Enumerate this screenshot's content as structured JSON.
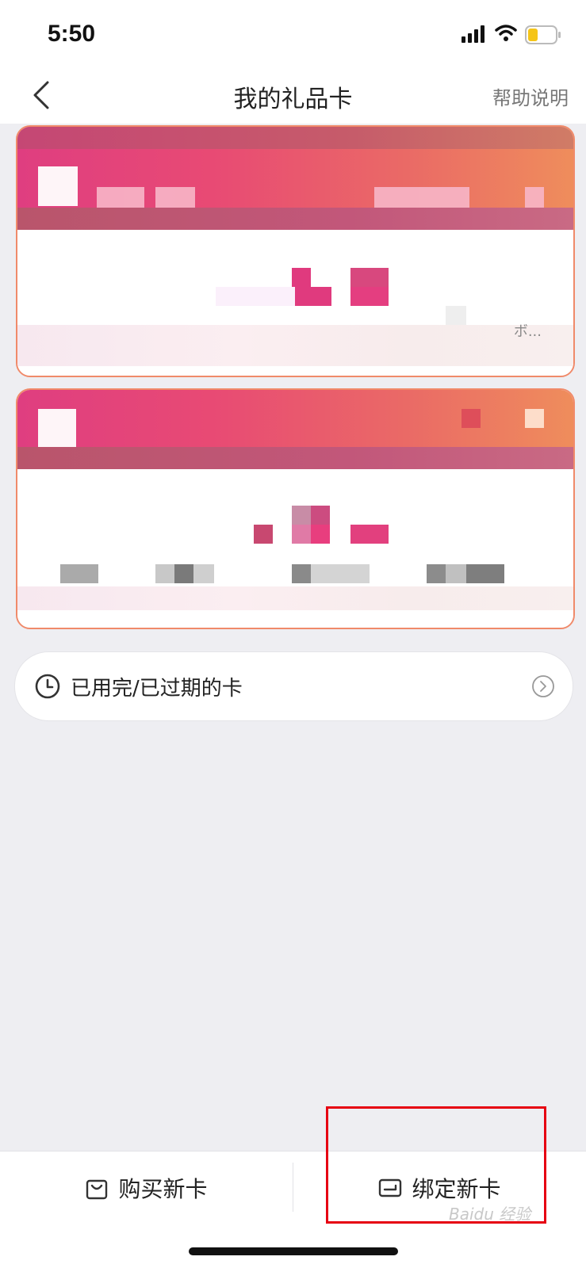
{
  "status_bar": {
    "time": "5:50",
    "icons": [
      "signal-icon",
      "wifi-icon",
      "battery-icon"
    ],
    "battery_color": "#f5c518"
  },
  "nav": {
    "title": "我的礼品卡",
    "help_label": "帮助说明",
    "back_icon": "chevron-left-icon"
  },
  "cards": [
    {
      "note": "ボ..."
    },
    {
      "note": ""
    }
  ],
  "expired": {
    "label": "已用完/已过期的卡",
    "icon": "clock-icon",
    "chevron_icon": "chevron-circle-icon"
  },
  "bottom_bar": {
    "buy_label": "购买新卡",
    "bind_label": "绑定新卡",
    "buy_icon": "bag-icon",
    "bind_icon": "card-icon"
  },
  "watermark": "Baidu 经验",
  "colors": {
    "accent_pink": "#e84a74",
    "accent_orange": "#ef8d5c",
    "highlight_red": "#e60012",
    "background": "#eeeef2"
  }
}
